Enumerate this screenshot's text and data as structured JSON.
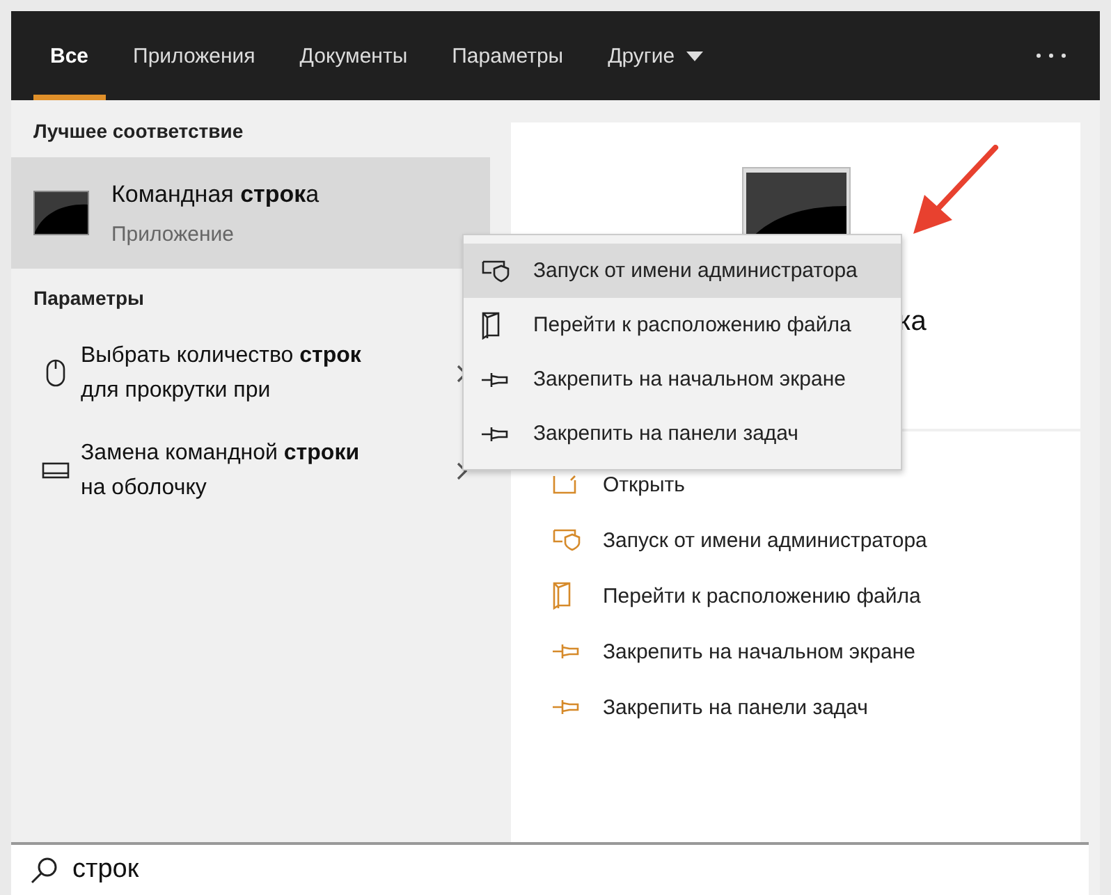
{
  "tabs": [
    {
      "label": "Все",
      "selected": true,
      "dropdown": false
    },
    {
      "label": "Приложения",
      "selected": false,
      "dropdown": false
    },
    {
      "label": "Документы",
      "selected": false,
      "dropdown": false
    },
    {
      "label": "Параметры",
      "selected": false,
      "dropdown": false
    },
    {
      "label": "Другие",
      "selected": false,
      "dropdown": true
    }
  ],
  "best_match": {
    "heading": "Лучшее соответствие",
    "title": "Командная **строк**а",
    "subtitle": "Приложение",
    "selected": true
  },
  "settings": {
    "heading": "Параметры",
    "items": [
      {
        "kind": "mouse",
        "text": "Выбрать количество **строк** для прокрутки при"
      },
      {
        "kind": "display",
        "text": "Замена командной **строки** на оболочку"
      }
    ]
  },
  "preview": {
    "title": "ка",
    "actions": [
      {
        "kind": "open",
        "label": "Открыть"
      },
      {
        "kind": "admin",
        "label": "Запуск от имени администратора"
      },
      {
        "kind": "folder",
        "label": "Перейти к расположению файла"
      },
      {
        "kind": "pin",
        "label": "Закрепить на начальном экране"
      },
      {
        "kind": "pin",
        "label": "Закрепить на панели задач"
      }
    ]
  },
  "context_menu": {
    "items": [
      {
        "kind": "admin",
        "label": "Запуск от имени администратора",
        "selected": true
      },
      {
        "kind": "folder",
        "label": "Перейти к расположению файла",
        "selected": false
      },
      {
        "kind": "pin",
        "label": "Закрепить на начальном экране",
        "selected": false
      },
      {
        "kind": "pin",
        "label": "Закрепить на панели задач",
        "selected": false
      }
    ]
  },
  "search": {
    "value": "строк"
  }
}
